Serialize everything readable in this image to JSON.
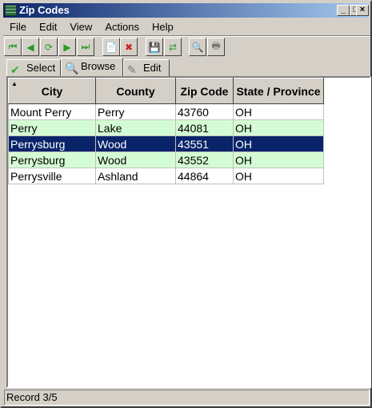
{
  "window": {
    "title": "Zip Codes"
  },
  "menu": [
    "File",
    "Edit",
    "View",
    "Actions",
    "Help"
  ],
  "toolbar": [
    {
      "name": "first-record",
      "glyph": "⏮",
      "color": "#2a9a2a"
    },
    {
      "name": "prev-record",
      "glyph": "◀",
      "color": "#2a9a2a"
    },
    {
      "name": "refresh",
      "glyph": "⟳",
      "color": "#2a9a2a"
    },
    {
      "name": "next-record",
      "glyph": "▶",
      "color": "#2a9a2a"
    },
    {
      "name": "last-record",
      "glyph": "⏭",
      "color": "#2a9a2a"
    },
    {
      "name": "new-record",
      "glyph": "📄",
      "color": "#888"
    },
    {
      "name": "delete-record",
      "glyph": "✖",
      "color": "#d02020"
    },
    {
      "name": "save",
      "glyph": "💾",
      "color": "#333"
    },
    {
      "name": "save-copy",
      "glyph": "⇄",
      "color": "#2a9a2a"
    },
    {
      "name": "search",
      "glyph": "🔍",
      "color": "#336"
    },
    {
      "name": "print",
      "glyph": "🖶",
      "color": "#777"
    }
  ],
  "tabs": [
    {
      "label": "Select",
      "icon": "checkmark"
    },
    {
      "label": "Browse",
      "icon": "magnifier"
    },
    {
      "label": "Edit",
      "icon": "pencil"
    }
  ],
  "active_tab": "Browse",
  "grid": {
    "columns": [
      "City",
      "County",
      "Zip Code",
      "State / Province"
    ],
    "sorted_column": "City",
    "rows": [
      [
        "Mount Perry",
        "Perry",
        "43760",
        "OH"
      ],
      [
        "Perry",
        "Lake",
        "44081",
        "OH"
      ],
      [
        "Perrysburg",
        "Wood",
        "43551",
        "OH"
      ],
      [
        "Perrysburg",
        "Wood",
        "43552",
        "OH"
      ],
      [
        "Perrysville",
        "Ashland",
        "44864",
        "OH"
      ]
    ],
    "selected_row": 3
  },
  "status": "Record 3/5"
}
